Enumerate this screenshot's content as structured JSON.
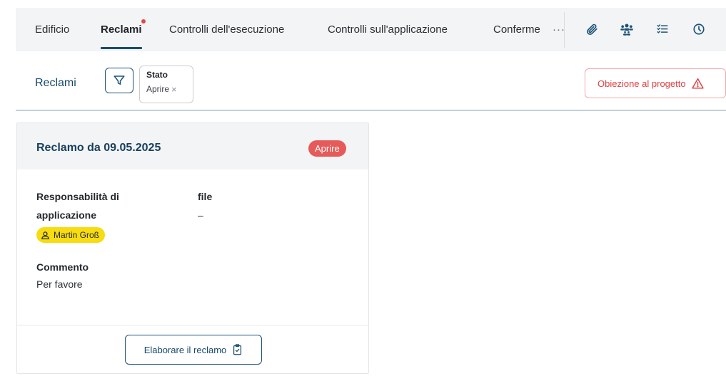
{
  "tabs": [
    {
      "label": "Edificio",
      "active": false
    },
    {
      "label": "Reclami",
      "active": true,
      "has_dot": true
    },
    {
      "label": "Controlli dell'esecuzione",
      "active": false
    },
    {
      "label": "Controlli sull'applicazione",
      "active": false
    },
    {
      "label": "Conferme",
      "active": false
    }
  ],
  "tabs_more": "···",
  "toolbar_icons": [
    "paperclip-icon",
    "people-icon",
    "checklist-icon",
    "clock-icon"
  ],
  "filter": {
    "title": "Reclami",
    "chip_label": "Stato",
    "chip_value": "Aprire",
    "chip_close": "×"
  },
  "objection_button": "Obiezione al progetto",
  "card": {
    "title": "Reclamo da 09.05.2025",
    "status": "Aprire",
    "responsibility_label_line1": "Responsabilità di",
    "responsibility_label_line2": "applicazione",
    "user_name": "Martin Groß",
    "file_label": "file",
    "file_value": "–",
    "comment_label": "Commento",
    "comment_value": "Per favore",
    "process_button": "Elaborare il reclamo"
  },
  "colors": {
    "primary": "#17486a",
    "danger": "#e65a5a",
    "user_chip": "#f6dc10",
    "bar_bg": "#f3f4f5"
  }
}
